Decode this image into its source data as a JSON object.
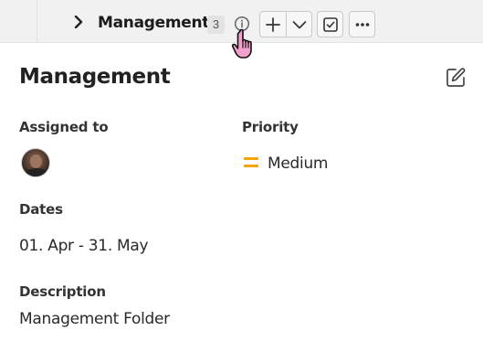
{
  "toolbar": {
    "folder_name": "Management",
    "item_count": "3",
    "icons": [
      "chevron-right-icon",
      "info-icon",
      "plus-icon",
      "chevron-down-icon",
      "checkbox-icon",
      "more-icon",
      "hand-pointer-icon"
    ]
  },
  "detail": {
    "title": "Management",
    "assigned_label": "Assigned to",
    "priority_label": "Priority",
    "priority_value": "Medium",
    "priority_color": "#f5a300",
    "dates_label": "Dates",
    "dates_value": "01. Apr - 31. May",
    "description_label": "Description",
    "description_value": "Management Folder"
  }
}
